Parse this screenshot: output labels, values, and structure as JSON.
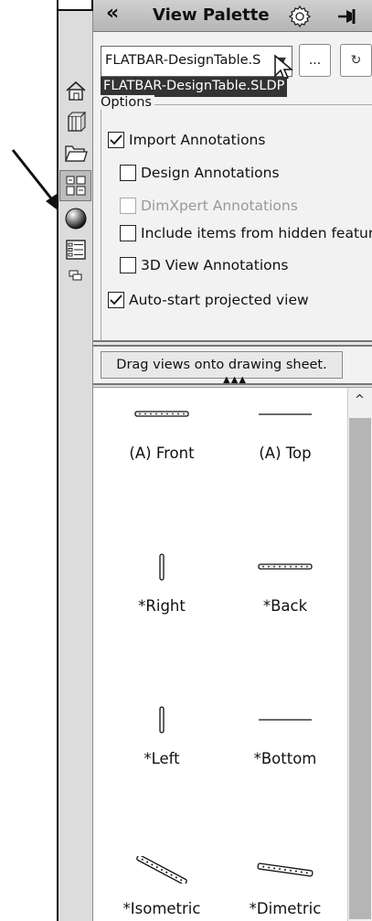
{
  "titlebar": {
    "collapse_glyph": "«",
    "title": "View Palette",
    "icons": [
      "gear-icon",
      "pin-icon"
    ]
  },
  "tabs": [
    {
      "name": "home-icon",
      "active": false
    },
    {
      "name": "parts-library-icon",
      "active": false
    },
    {
      "name": "file-explorer-icon",
      "active": false
    },
    {
      "name": "view-palette-icon",
      "active": true
    },
    {
      "name": "appearances-icon",
      "active": false
    },
    {
      "name": "custom-properties-icon",
      "active": false
    },
    {
      "name": "forum-icon",
      "active": false
    }
  ],
  "document": {
    "current": "FLATBAR-DesignTable.S",
    "suggestion": "FLATBAR-DesignTable.SLDP",
    "browse_label": "...",
    "refresh_icon": "refresh-icon"
  },
  "options": {
    "legend": "Options",
    "items": [
      {
        "label": "Import Annotations",
        "checked": true,
        "disabled": false
      },
      {
        "label": "Design Annotations",
        "checked": false,
        "disabled": false
      },
      {
        "label": "DimXpert Annotations",
        "checked": false,
        "disabled": true
      },
      {
        "label": "Include items from hidden feature",
        "checked": false,
        "disabled": false
      },
      {
        "label": "3D View Annotations",
        "checked": false,
        "disabled": false
      },
      {
        "label": "Auto-start projected view",
        "checked": true,
        "disabled": false
      }
    ]
  },
  "drag_hint": "Drag views onto drawing sheet.",
  "views": [
    {
      "label": "(A) Front",
      "thumb": "flatbar-front-thumbnail"
    },
    {
      "label": "(A) Top",
      "thumb": "flatbar-top-thumbnail"
    },
    {
      "label": "*Right",
      "thumb": "flatbar-right-thumbnail"
    },
    {
      "label": "*Back",
      "thumb": "flatbar-back-thumbnail"
    },
    {
      "label": "*Left",
      "thumb": "flatbar-left-thumbnail"
    },
    {
      "label": "*Bottom",
      "thumb": "flatbar-bottom-thumbnail"
    },
    {
      "label": "*Isometric",
      "thumb": "flatbar-isometric-thumbnail"
    },
    {
      "label": "*Dimetric",
      "thumb": "flatbar-dimetric-thumbnail"
    }
  ],
  "colors": {
    "titlebar": "#c2c2c2",
    "panel": "#f2f2f2",
    "tabstrip": "#dcdcdc",
    "selection": "#333333"
  }
}
